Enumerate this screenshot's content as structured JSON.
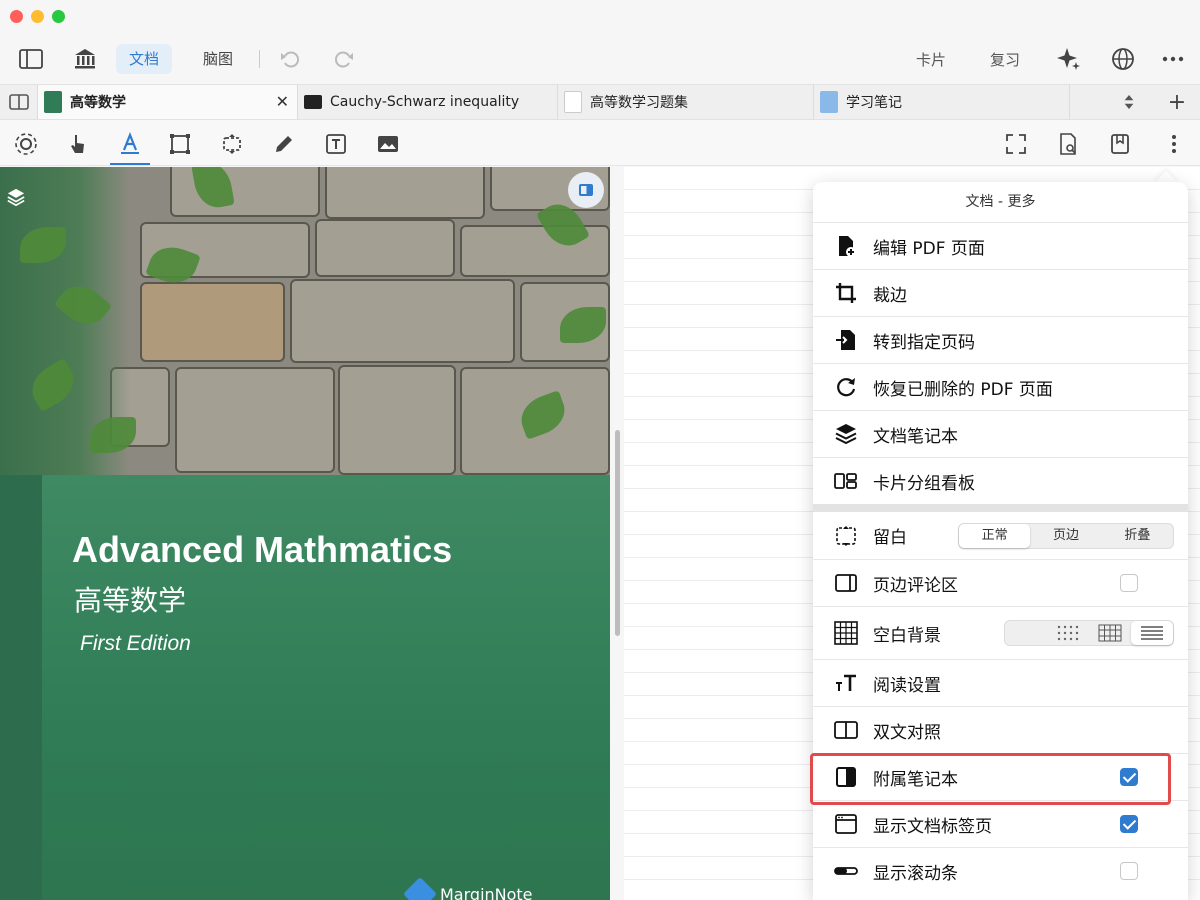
{
  "toolbar": {
    "mode_tabs": [
      "文档",
      "脑图"
    ],
    "right_labels": {
      "cards": "卡片",
      "review": "复习"
    }
  },
  "tabs": [
    {
      "label": "高等数学",
      "active": true
    },
    {
      "label": "Cauchy-Schwarz inequality",
      "active": false
    },
    {
      "label": "高等数学习题集",
      "active": false
    },
    {
      "label": "学习笔记",
      "active": false
    }
  ],
  "cover": {
    "title": "Advanced Mathmatics",
    "title_cn": "高等数学",
    "edition": "First Edition",
    "brand": "MarginNote"
  },
  "menu": {
    "title": "文档 - 更多",
    "items": [
      {
        "label": "编辑 PDF 页面",
        "icon": "edit-pdf-icon"
      },
      {
        "label": "裁边",
        "icon": "crop-icon"
      },
      {
        "label": "转到指定页码",
        "icon": "goto-page-icon"
      },
      {
        "label": "恢复已删除的 PDF 页面",
        "icon": "restore-icon"
      },
      {
        "label": "文档笔记本",
        "icon": "layers-icon"
      },
      {
        "label": "卡片分组看板",
        "icon": "board-icon"
      }
    ],
    "margin": {
      "label": "留白",
      "options": [
        "正常",
        "页边",
        "折叠"
      ],
      "selected": "正常"
    },
    "comment_area": {
      "label": "页边评论区",
      "checked": false
    },
    "blank_bg": {
      "label": "空白背景"
    },
    "reading": {
      "label": "阅读设置"
    },
    "bilingual": {
      "label": "双文对照"
    },
    "attached_notebook": {
      "label": "附属笔记本",
      "checked": true
    },
    "show_tabs": {
      "label": "显示文档标签页",
      "checked": true
    },
    "show_scrollbar": {
      "label": "显示滚动条",
      "checked": false
    }
  },
  "colors": {
    "accent": "#2f7bd0",
    "highlight": "#e14b4b",
    "cover_green": "#2f7c56"
  }
}
